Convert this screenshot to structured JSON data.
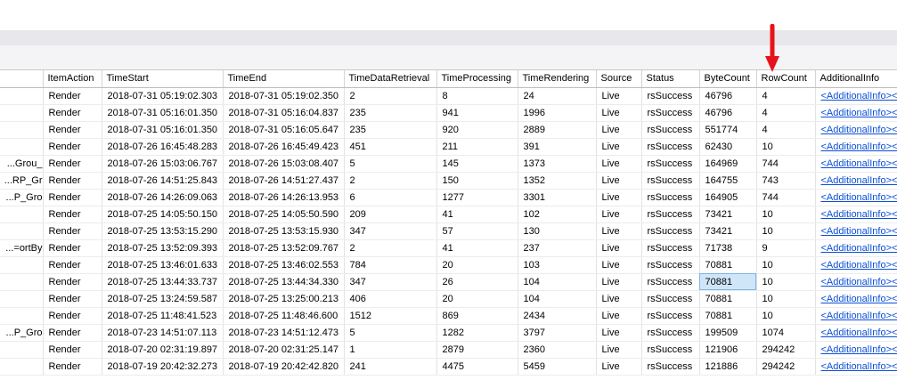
{
  "columns": [
    "",
    "ItemAction",
    "TimeStart",
    "TimeEnd",
    "TimeDataRetrieval",
    "TimeProcessing",
    "TimeRendering",
    "Source",
    "Status",
    "ByteCount",
    "RowCount",
    "AdditionalInfo"
  ],
  "rows": [
    [
      "",
      "Render",
      "2018-07-31 05:19:02.303",
      "2018-07-31 05:19:02.350",
      "2",
      "8",
      "24",
      "Live",
      "rsSuccess",
      "46796",
      "4",
      "<AdditionalInfo><P"
    ],
    [
      "",
      "Render",
      "2018-07-31 05:16:01.350",
      "2018-07-31 05:16:04.837",
      "235",
      "941",
      "1996",
      "Live",
      "rsSuccess",
      "46796",
      "4",
      "<AdditionalInfo><P"
    ],
    [
      "",
      "Render",
      "2018-07-31 05:16:01.350",
      "2018-07-31 05:16:05.647",
      "235",
      "920",
      "2889",
      "Live",
      "rsSuccess",
      "551774",
      "4",
      "<AdditionalInfo><P"
    ],
    [
      "",
      "Render",
      "2018-07-26 16:45:48.283",
      "2018-07-26 16:45:49.423",
      "451",
      "211",
      "391",
      "Live",
      "rsSuccess",
      "62430",
      "10",
      "<AdditionalInfo><P"
    ],
    [
      "_Grou...",
      "Render",
      "2018-07-26 15:03:06.767",
      "2018-07-26 15:03:08.407",
      "5",
      "145",
      "1373",
      "Live",
      "rsSuccess",
      "164969",
      "744",
      "<AdditionalInfo><P"
    ],
    [
      "RP_Gr...",
      "Render",
      "2018-07-26 14:51:25.843",
      "2018-07-26 14:51:27.437",
      "2",
      "150",
      "1352",
      "Live",
      "rsSuccess",
      "164755",
      "743",
      "<AdditionalInfo><P"
    ],
    [
      "P_Gro...",
      "Render",
      "2018-07-26 14:26:09.063",
      "2018-07-26 14:26:13.953",
      "6",
      "1277",
      "3301",
      "Live",
      "rsSuccess",
      "164905",
      "744",
      "<AdditionalInfo><P"
    ],
    [
      "",
      "Render",
      "2018-07-25 14:05:50.150",
      "2018-07-25 14:05:50.590",
      "209",
      "41",
      "102",
      "Live",
      "rsSuccess",
      "73421",
      "10",
      "<AdditionalInfo><P"
    ],
    [
      "",
      "Render",
      "2018-07-25 13:53:15.290",
      "2018-07-25 13:53:15.930",
      "347",
      "57",
      "130",
      "Live",
      "rsSuccess",
      "73421",
      "10",
      "<AdditionalInfo><P"
    ],
    [
      "ortBy=...",
      "Render",
      "2018-07-25 13:52:09.393",
      "2018-07-25 13:52:09.767",
      "2",
      "41",
      "237",
      "Live",
      "rsSuccess",
      "71738",
      "9",
      "<AdditionalInfo><P"
    ],
    [
      "",
      "Render",
      "2018-07-25 13:46:01.633",
      "2018-07-25 13:46:02.553",
      "784",
      "20",
      "103",
      "Live",
      "rsSuccess",
      "70881",
      "10",
      "<AdditionalInfo><P"
    ],
    [
      "",
      "Render",
      "2018-07-25 13:44:33.737",
      "2018-07-25 13:44:34.330",
      "347",
      "26",
      "104",
      "Live",
      "rsSuccess",
      "70881",
      "10",
      "<AdditionalInfo><P"
    ],
    [
      "",
      "Render",
      "2018-07-25 13:24:59.587",
      "2018-07-25 13:25:00.213",
      "406",
      "20",
      "104",
      "Live",
      "rsSuccess",
      "70881",
      "10",
      "<AdditionalInfo><P"
    ],
    [
      "",
      "Render",
      "2018-07-25 11:48:41.523",
      "2018-07-25 11:48:46.600",
      "1512",
      "869",
      "2434",
      "Live",
      "rsSuccess",
      "70881",
      "10",
      "<AdditionalInfo><P"
    ],
    [
      "P_Gro...",
      "Render",
      "2018-07-23 14:51:07.113",
      "2018-07-23 14:51:12.473",
      "5",
      "1282",
      "3797",
      "Live",
      "rsSuccess",
      "199509",
      "1074",
      "<AdditionalInfo><P"
    ],
    [
      "",
      "Render",
      "2018-07-20 02:31:19.897",
      "2018-07-20 02:31:25.147",
      "1",
      "2879",
      "2360",
      "Live",
      "rsSuccess",
      "121906",
      "294242",
      "<AdditionalInfo><P"
    ],
    [
      "",
      "Render",
      "2018-07-19 20:42:32.273",
      "2018-07-19 20:42:42.820",
      "241",
      "4475",
      "5459",
      "Live",
      "rsSuccess",
      "121886",
      "294242",
      "<AdditionalInfo><P"
    ]
  ],
  "selected_cell": {
    "row": 11,
    "col": 9
  },
  "colors": {
    "annotation_arrow": "#e8121b",
    "link": "#0b4ed8",
    "selection": "#cfe6f9"
  }
}
